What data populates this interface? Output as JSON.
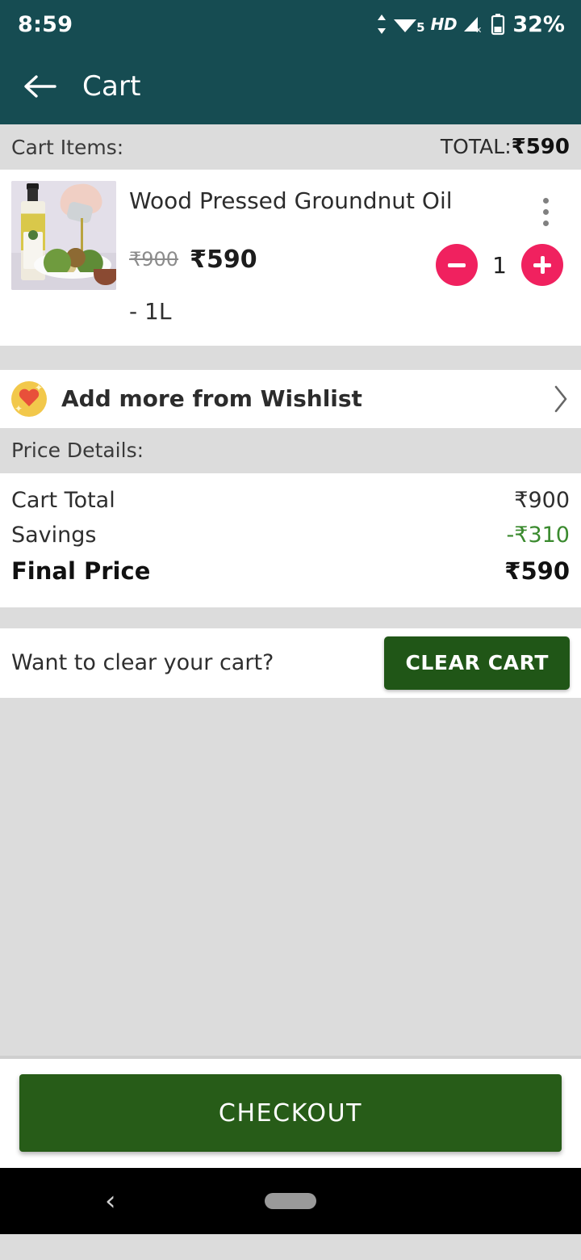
{
  "status_bar": {
    "time": "8:59",
    "wifi_label": "5",
    "hd_label": "HD",
    "battery_percent": "32%"
  },
  "app_bar": {
    "back_icon": "arrow-left-icon",
    "title": "Cart",
    "background_color": "#164c52"
  },
  "cart_section": {
    "label": "Cart Items:",
    "total_prefix": "TOTAL:",
    "total_value": "₹590"
  },
  "item": {
    "title": "Wood Pressed Groundnut Oil",
    "price_old": "₹900",
    "price_new": "₹590",
    "variant": "- 1L",
    "quantity": "1",
    "decrease_label": "−",
    "increase_label": "+",
    "menu_icon": "kebab-menu-icon",
    "stepper_color": "#f0215f"
  },
  "wishlist": {
    "label": "Add more from Wishlist",
    "icon": "heart-icon",
    "chevron": "›"
  },
  "price_details": {
    "heading": "Price Details:",
    "rows": [
      {
        "name": "Cart Total",
        "value": "₹900"
      },
      {
        "name": "Savings",
        "value": "-₹310"
      },
      {
        "name": "Final Price",
        "value": "₹590"
      }
    ],
    "savings_color": "#3a8a2e"
  },
  "clear_cart": {
    "question": "Want to clear your cart?",
    "button_label": "CLEAR CART",
    "button_color": "#205617"
  },
  "checkout": {
    "button_label": "CHECKOUT",
    "button_color": "#275c18"
  },
  "nav_bar": {
    "back_icon": "nav-back-icon",
    "home_pill": "nav-home-pill"
  }
}
